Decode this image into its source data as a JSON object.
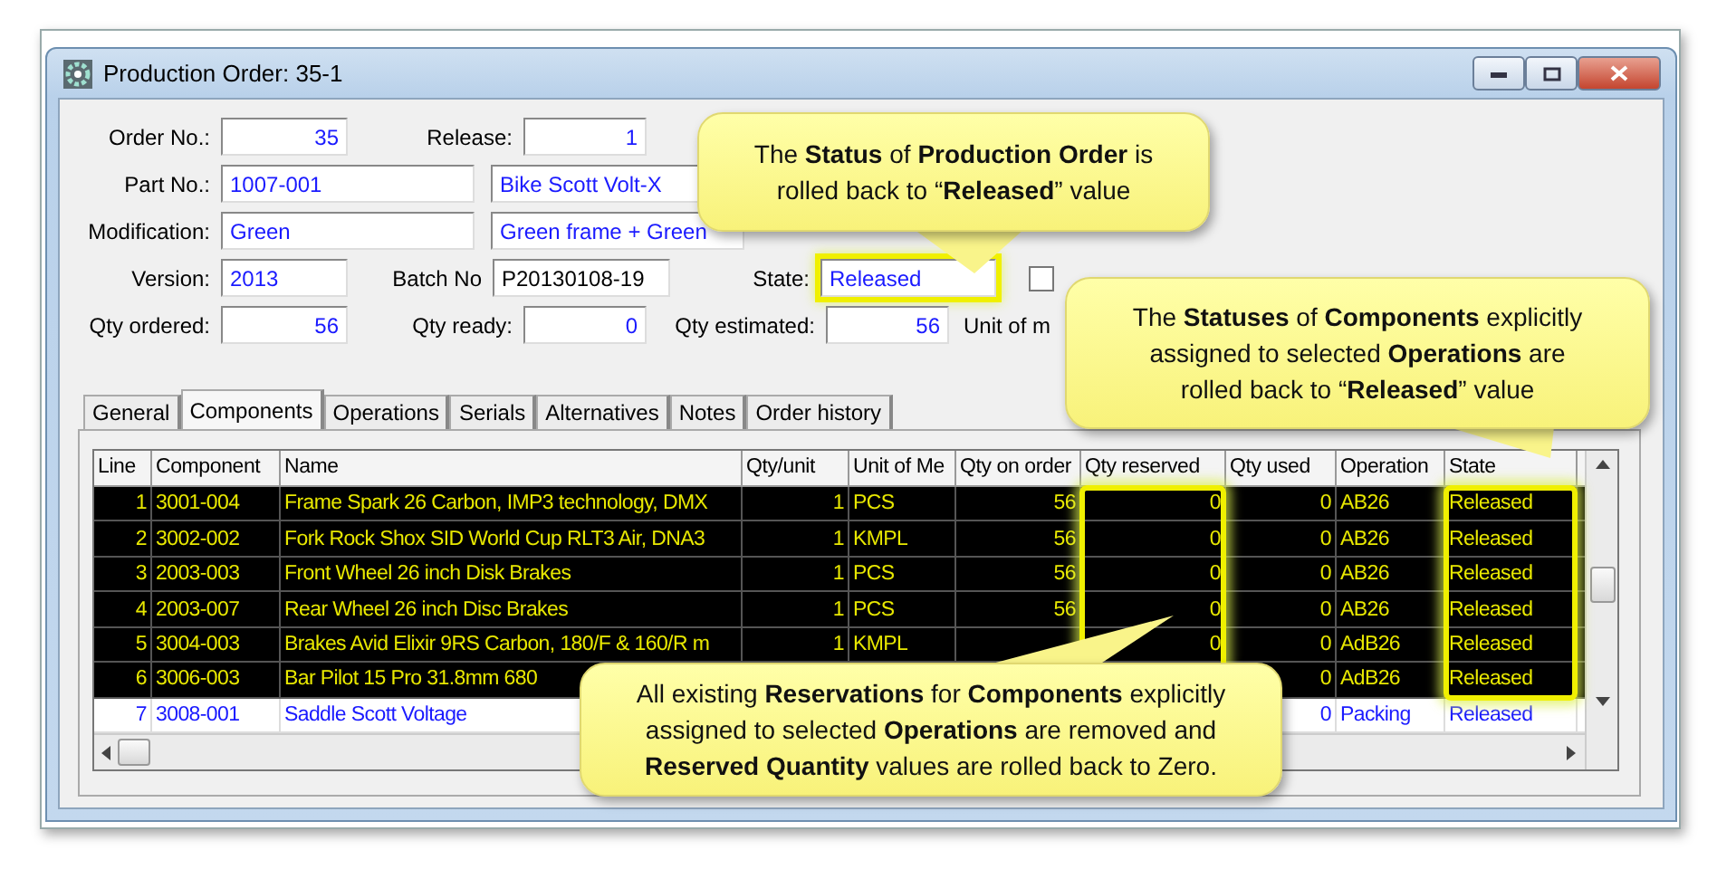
{
  "window": {
    "title": "Production Order: 35-1"
  },
  "form_rows": [
    [
      {
        "label": "Order No.:",
        "value": "35",
        "kind": "number"
      },
      {
        "label": "Release:",
        "value": "1",
        "kind": "number"
      }
    ],
    [
      {
        "label": "Part No.:",
        "value": "1007-001",
        "kind": "text"
      },
      {
        "value": "Bike Scott Volt-X",
        "kind": "text"
      }
    ],
    [
      {
        "label": "Modification:",
        "value": "Green",
        "kind": "text"
      },
      {
        "value": "Green frame + Green",
        "kind": "text"
      }
    ],
    [
      {
        "label": "Version:",
        "value": "2013",
        "kind": "text"
      },
      {
        "label": "Batch No",
        "value": "P20130108-19",
        "kind": "plain"
      },
      {
        "label": "State:",
        "value": "Released",
        "kind": "text",
        "highlighted": true
      },
      {
        "kind": "checkbox",
        "checked": false
      }
    ],
    [
      {
        "label": "Qty ordered:",
        "value": "56",
        "kind": "number"
      },
      {
        "label": "Qty ready:",
        "value": "0",
        "kind": "number"
      },
      {
        "label": "Qty estimated:",
        "value": "56",
        "kind": "number"
      },
      {
        "label": "Unit of m",
        "kind": "caption"
      }
    ]
  ],
  "tabs": [
    {
      "label": "General",
      "selected": false
    },
    {
      "label": "Components",
      "selected": true
    },
    {
      "label": "Operations",
      "selected": false
    },
    {
      "label": "Serials",
      "selected": false
    },
    {
      "label": "Alternatives",
      "selected": false
    },
    {
      "label": "Notes",
      "selected": false
    },
    {
      "label": "Order history",
      "selected": false
    }
  ],
  "table": {
    "columns": [
      {
        "label": "Line",
        "highlighted": false
      },
      {
        "label": "Component",
        "highlighted": false
      },
      {
        "label": "Name",
        "highlighted": false
      },
      {
        "label": "Qty/unit",
        "highlighted": false
      },
      {
        "label": "Unit of Me",
        "highlighted": false
      },
      {
        "label": "Qty on order",
        "highlighted": false
      },
      {
        "label": "Qty reserved",
        "highlighted": true
      },
      {
        "label": "Qty used",
        "highlighted": false
      },
      {
        "label": "Operation",
        "highlighted": false
      },
      {
        "label": "State",
        "highlighted": true
      }
    ],
    "rows": [
      {
        "selected": true,
        "cells": [
          "1",
          "3001-004",
          "Frame Spark 26 Carbon, IMP3 technology, DMX",
          "1",
          "PCS",
          "56",
          "0",
          "0",
          "AB26",
          "Released"
        ]
      },
      {
        "selected": true,
        "cells": [
          "2",
          "3002-002",
          "Fork Rock Shox SID World Cup RLT3 Air, DNA3",
          "1",
          "KMPL",
          "56",
          "0",
          "0",
          "AB26",
          "Released"
        ]
      },
      {
        "selected": true,
        "cells": [
          "3",
          "2003-003",
          "Front Wheel 26 inch Disk Brakes",
          "1",
          "PCS",
          "56",
          "0",
          "0",
          "AB26",
          "Released"
        ]
      },
      {
        "selected": true,
        "cells": [
          "4",
          "2003-007",
          "Rear Wheel 26 inch Disc Brakes",
          "1",
          "PCS",
          "56",
          "0",
          "0",
          "AB26",
          "Released"
        ]
      },
      {
        "selected": true,
        "cells": [
          "5",
          "3004-003",
          "Brakes Avid Elixir 9RS Carbon, 180/F & 160/R m",
          "1",
          "KMPL",
          null,
          "0",
          "0",
          "AdB26",
          "Released"
        ]
      },
      {
        "selected": true,
        "cells": [
          "6",
          "3006-003",
          "Bar Pilot 15 Pro 31.8mm 680",
          null,
          null,
          null,
          null,
          "0",
          "AdB26",
          "Released"
        ]
      },
      {
        "selected": false,
        "cells": [
          "7",
          "3008-001",
          "Saddle Scott Voltage",
          null,
          null,
          null,
          null,
          "0",
          "Packing",
          "Released"
        ]
      }
    ]
  },
  "callouts": [
    {
      "text": "The **Status** of **Production Order** is\nrolled back to “**Released**” value"
    },
    {
      "text": "The **Statuses** of **Components** explicitly\nassigned to selected **Operations** are\nrolled back to “**Released**” value"
    },
    {
      "text": "All existing **Reservations** for **Components** explicitly\nassigned to selected **Operations** are removed and\n**Reserved Quantity** values are rolled back to Zero."
    }
  ]
}
